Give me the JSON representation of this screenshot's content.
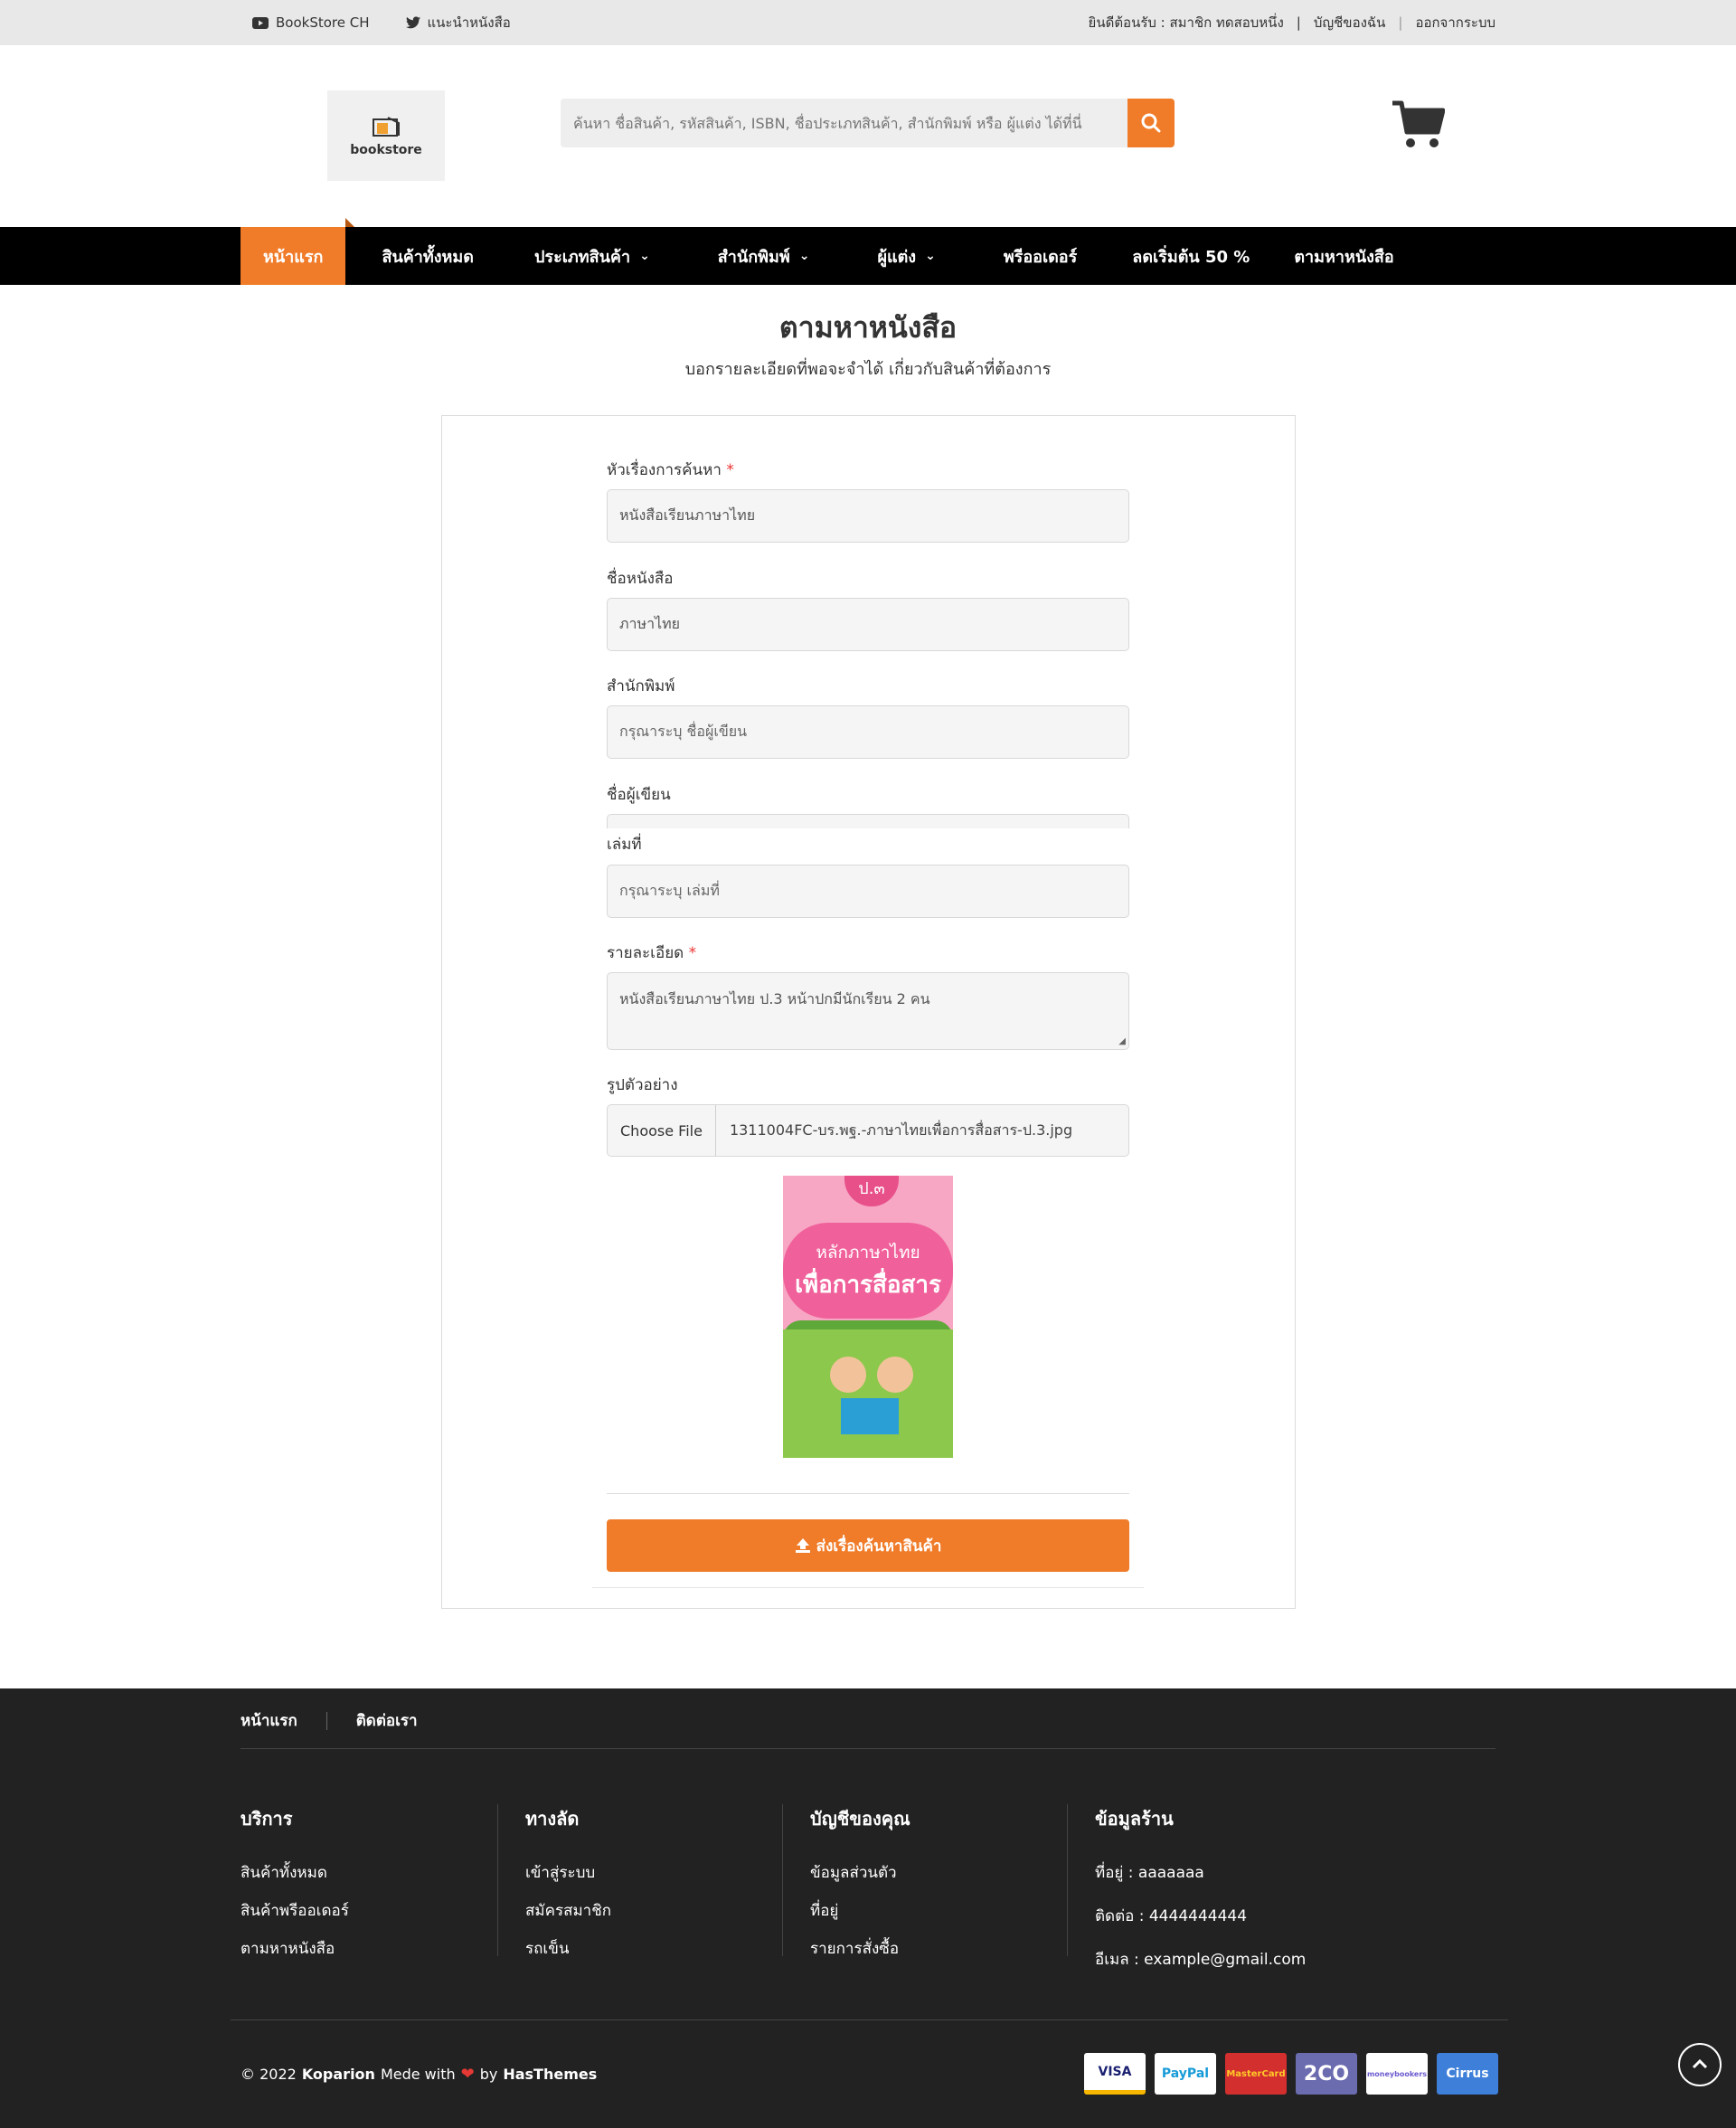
{
  "topbar": {
    "youtube_label": "BookStore CH",
    "twitter_label": "แนะนำหนังสือ",
    "welcome": "ยินดีต้อนรับ : สมาชิก ทดสอบหนึ่ง",
    "sep1": "|",
    "account": "บัญชีของฉัน",
    "sep2": "|",
    "logout": "ออกจากระบบ"
  },
  "header": {
    "logo_text": "bookstore",
    "search_placeholder": "ค้นหา ชื่อสินค้า, รหัสสินค้า, ISBN, ชื่อประเภทสินค้า, สำนักพิมพ์ หรือ ผู้แต่ง ได้ที่นี่"
  },
  "nav": {
    "items": [
      {
        "label": "หน้าแรก"
      },
      {
        "label": "สินค้าทั้งหมด"
      },
      {
        "label": "ประเภทสินค้า"
      },
      {
        "label": "สำนักพิมพ์"
      },
      {
        "label": "ผู้แต่ง"
      },
      {
        "label": "พรีออเดอร์"
      },
      {
        "label": "ลดเริ่มต้น 50 %"
      },
      {
        "label": "ตามหาหนังสือ"
      }
    ],
    "chevron": "⌄"
  },
  "page": {
    "title": "ตามหาหนังสือ",
    "subtitle": "บอกรายละเอียดที่พอจะจำได้ เกี่ยวกับสินค้าที่ต้องการ"
  },
  "form": {
    "required_mark": "*",
    "subject_label": "หัวเรื่องการค้นหา",
    "subject_value": "หนังสือเรียนภาษาไทย",
    "bookname_label": "ชื่อหนังสือ",
    "bookname_value": "ภาษาไทย",
    "publisher_label": "สำนักพิมพ์",
    "publisher_placeholder": "กรุณาระบุ ชื่อผู้เขียน",
    "author_label": "ชื่อผู้เขียน",
    "volume_label": "เล่มที่",
    "volume_placeholder": "กรุณาระบุ เล่มที่",
    "detail_label": "รายละเอียด",
    "detail_value": "หนังสือเรียนภาษาไทย ป.3 หน้าปกมีนักเรียน 2 คน",
    "image_label": "รูปตัวอย่าง",
    "choose_file": "Choose File",
    "file_name": "1311004FC-บร.พฐ.-ภาษาไทยเพื่อการสื่อสาร-ป.3.jpg",
    "preview": {
      "grade": "ป.๓",
      "line1": "หลักภาษาไทย",
      "line2": "เพื่อการสื่อสาร"
    },
    "submit_label": "ส่งเรื่องค้นหาสินค้า"
  },
  "footer": {
    "top_links": [
      "หน้าแรก",
      "ติดต่อเรา"
    ],
    "columns": [
      {
        "title": "บริการ",
        "links": [
          "สินค้าทั้งหมด",
          "สินค้าพรีออเดอร์",
          "ตามหาหนังสือ"
        ]
      },
      {
        "title": "ทางลัด",
        "links": [
          "เข้าสู่ระบบ",
          "สมัครสมาชิก",
          "รถเข็น"
        ]
      },
      {
        "title": "บัญชีของคุณ",
        "links": [
          "ข้อมูลส่วนตัว",
          "ที่อยู่",
          "รายการสั่งซื้อ"
        ]
      }
    ],
    "shop": {
      "title": "ข้อมูลร้าน",
      "address": "ที่อยู่ : aaaaaaa",
      "phone": "ติดต่อ : 4444444444",
      "email": "อีเมล : example@gmail.com"
    },
    "copyright": {
      "prefix": "© 2022",
      "brand": "Koparion",
      "made": "Mede with",
      "heart": "❤",
      "by": "by",
      "author": "HasThemes"
    },
    "payments": [
      {
        "label": "VISA",
        "bg": "#ffffff",
        "fg": "#1a1f71"
      },
      {
        "label": "PayPal",
        "bg": "#ffffff",
        "fg": "#179bd7"
      },
      {
        "label": "MasterCard",
        "bg": "#d32f2f",
        "fg": "#ffca28"
      },
      {
        "label": "2CO",
        "bg": "#6b6bb0",
        "fg": "#ffffff"
      },
      {
        "label": "moneybookers",
        "bg": "#ffffff",
        "fg": "#6a5acd"
      },
      {
        "label": "Cirrus",
        "bg": "#3d7fd9",
        "fg": "#ffffff"
      }
    ]
  },
  "colors": {
    "accent": "#f07c2a",
    "nav_bg": "#000000",
    "footer_bg": "#222222"
  }
}
